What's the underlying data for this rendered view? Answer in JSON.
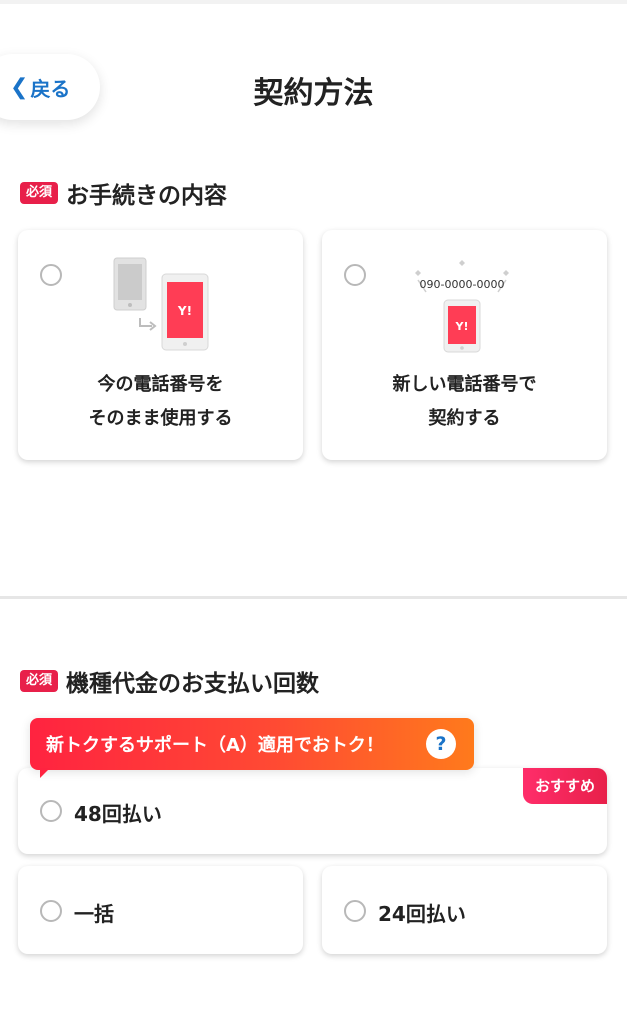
{
  "header": {
    "back_label": "戻る",
    "title": "契約方法"
  },
  "procedure": {
    "required_badge": "必須",
    "label": "お手続きの内容",
    "options": [
      {
        "line1": "今の電話番号を",
        "line2": "そのまま使用する",
        "icon": "phone-transfer-icon"
      },
      {
        "line1": "新しい電話番号で",
        "line2": "契約する",
        "phone_number": "090-0000-0000",
        "icon": "new-phone-icon"
      }
    ],
    "phone_logo": "Y!"
  },
  "payment": {
    "required_badge": "必須",
    "label": "機種代金のお支払い回数",
    "promo_text": "新トクするサポート（A）適用でおトク！",
    "help_symbol": "?",
    "recommended_badge": "おすすめ",
    "options": [
      "48回払い",
      "一括",
      "24回払い"
    ]
  },
  "colors": {
    "accent_red": "#e8204a",
    "link_blue": "#1a73c8",
    "phone_red": "#ff3d55"
  }
}
